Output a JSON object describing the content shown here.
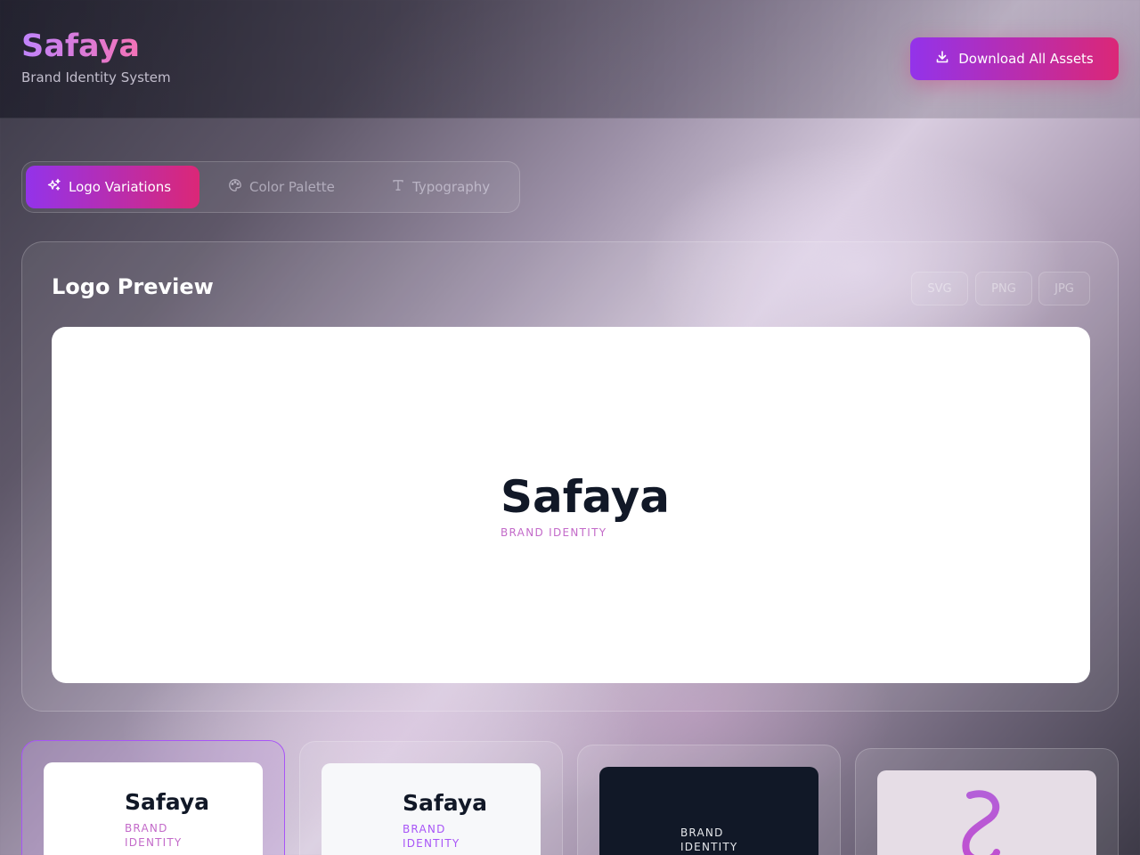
{
  "header": {
    "title": "Safaya",
    "subtitle": "Brand Identity System",
    "download_label": "Download All Assets"
  },
  "tabs": [
    {
      "label": "Logo Variations",
      "icon": "sparkles-icon",
      "active": true
    },
    {
      "label": "Color Palette",
      "icon": "palette-icon",
      "active": false
    },
    {
      "label": "Typography",
      "icon": "type-icon",
      "active": false
    }
  ],
  "preview": {
    "title": "Logo Preview",
    "formats": [
      "SVG",
      "PNG",
      "JPG"
    ],
    "logo_name": "Safaya",
    "logo_tagline": "BRAND IDENTITY"
  },
  "variants": [
    {
      "name": "Safaya",
      "tagline": "BRAND IDENTITY",
      "theme": "light",
      "selected": true
    },
    {
      "name": "Safaya",
      "tagline": "BRAND IDENTITY",
      "theme": "light-gray",
      "selected": false
    },
    {
      "name": "",
      "tagline": "BRAND IDENTITY",
      "theme": "dark",
      "selected": false
    },
    {
      "name": "",
      "tagline": "",
      "theme": "icon",
      "icon": "s-mark-icon",
      "selected": false
    }
  ],
  "colors": {
    "accent_start": "#9333ea",
    "accent_end": "#db2777",
    "logo_text": "#111827",
    "tagline_pink": "#c36ac9",
    "tagline_purple": "#a855f7"
  }
}
